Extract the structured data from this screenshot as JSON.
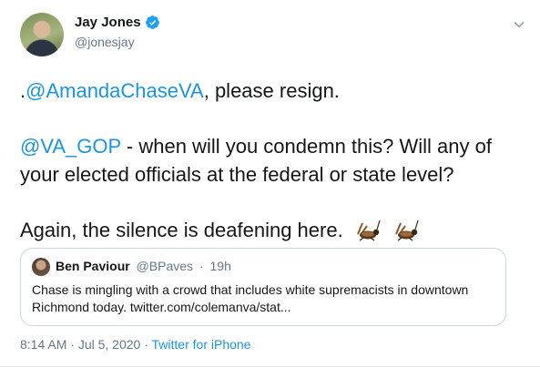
{
  "author": {
    "name": "Jay Jones",
    "handle": "@jonesjay",
    "verified": true
  },
  "tweet": {
    "line1": {
      "mention": "@AmandaChaseVA",
      "prefix": ".",
      "suffix": ", please resign."
    },
    "line2": {
      "mention": "@VA_GOP",
      "text": " - when will you condemn this? Will any of your elected officials at the federal or state level?"
    },
    "line3": {
      "text": "Again, the silence is deafening here."
    },
    "emoji": "cricket-icon"
  },
  "quoted": {
    "name": "Ben Paviour",
    "handle": "@BPaves",
    "separator": "·",
    "time": "19h",
    "text": "Chase is mingling with a crowd that includes white supremacists in downtown Richmond today. twitter.com/colemanva/stat..."
  },
  "footer": {
    "time": "8:14 AM",
    "separator1": "·",
    "date": "Jul 5, 2020",
    "separator2": "·",
    "source": "Twitter for iPhone"
  },
  "colors": {
    "link": "#1b95e0",
    "secondary": "#657786",
    "border": "#ccd6dd"
  }
}
